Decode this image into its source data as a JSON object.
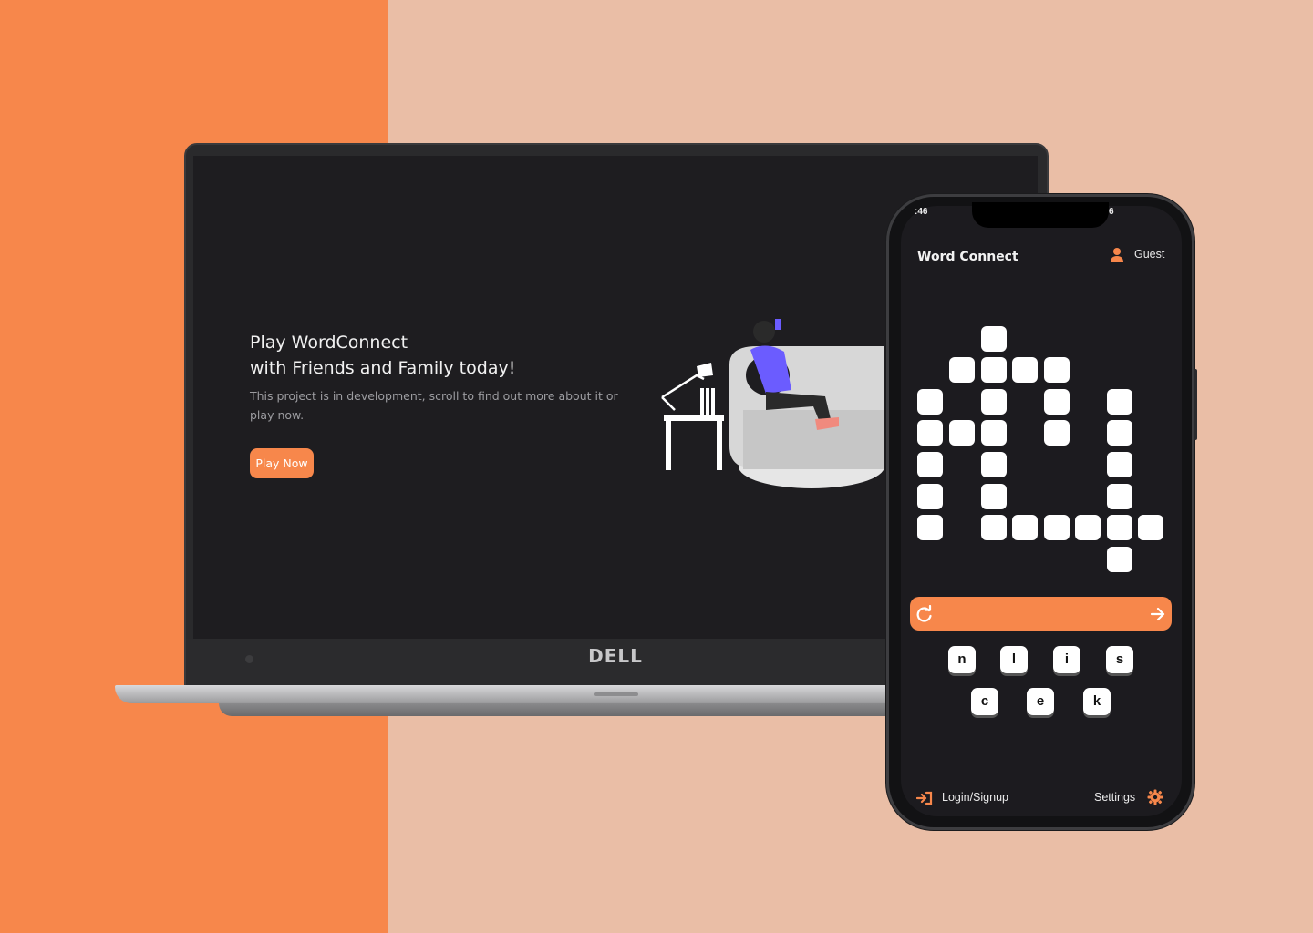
{
  "colors": {
    "accent": "#f7874b",
    "background_left": "#f7874b",
    "background_right": "#eabea6",
    "screen_bg": "#1e1d20"
  },
  "laptop": {
    "brand": "DELL",
    "hero": {
      "title_line1": "Play WordConnect",
      "title_line2": "with Friends and Family today!",
      "subtitle": "This project is in development, scroll to find out more about it or play now.",
      "cta_label": "Play Now"
    }
  },
  "phone": {
    "status": {
      "time": ":46",
      "right": "6"
    },
    "app_title": "Word Connect",
    "user_label": "Guest",
    "letters": [
      "n",
      "l",
      "i",
      "s",
      "c",
      "e",
      "k"
    ],
    "footer": {
      "login_label": "Login/Signup",
      "settings_label": "Settings"
    },
    "icons": [
      "user-icon",
      "refresh-icon",
      "arrow-right-icon",
      "login-icon",
      "gear-icon"
    ]
  }
}
